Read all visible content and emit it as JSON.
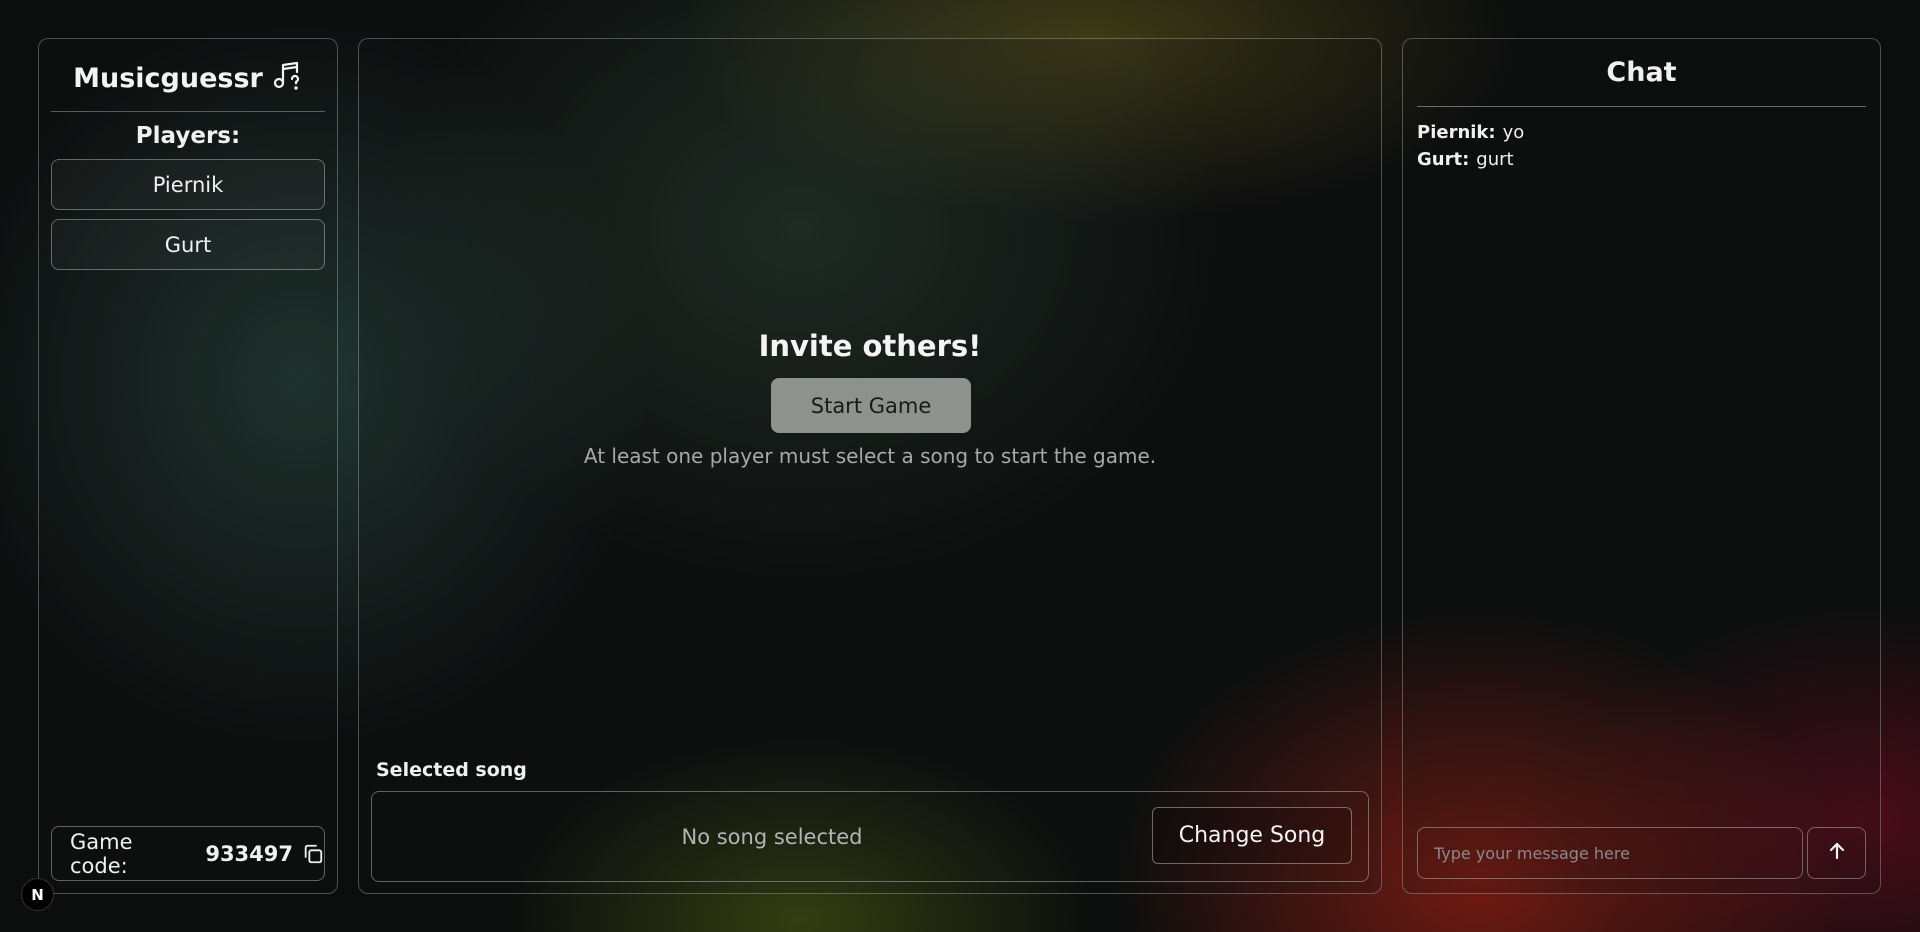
{
  "app": {
    "title": "Musicguessr",
    "logo_icon": "music-note-question-icon"
  },
  "players": {
    "heading": "Players:",
    "list": [
      {
        "name": "Piernik"
      },
      {
        "name": "Gurt"
      }
    ]
  },
  "game_code": {
    "label": "Game code:",
    "value": "933497",
    "copy_icon": "copy-icon"
  },
  "lobby": {
    "heading": "Invite others!",
    "start_button": "Start Game",
    "hint": "At least one player must select a song to start the game."
  },
  "song": {
    "label": "Selected song",
    "status": "No song selected",
    "change_button": "Change Song"
  },
  "chat": {
    "title": "Chat",
    "messages": [
      {
        "author": "Piernik:",
        "text": "yo"
      },
      {
        "author": "Gurt:",
        "text": "gurt"
      }
    ],
    "input_placeholder": "Type your message here",
    "send_icon": "arrow-up-icon"
  },
  "badge": {
    "letter": "N"
  },
  "colors": {
    "start_button_bg": "#8d928d",
    "panel_border": "#c8c8c8"
  }
}
